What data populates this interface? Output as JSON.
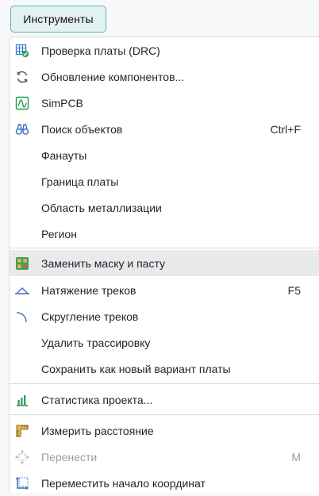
{
  "menubar": {
    "button_label": "Инструменты"
  },
  "menu": {
    "items": [
      {
        "label": "Проверка платы (DRC)",
        "shortcut": "",
        "icon": "drc-check-icon"
      },
      {
        "label": "Обновление компонентов...",
        "shortcut": "",
        "icon": "refresh-icon"
      },
      {
        "label": "SimPCB",
        "shortcut": "",
        "icon": "simpcb-icon"
      },
      {
        "label": "Поиск объектов",
        "shortcut": "Ctrl+F",
        "icon": "binoculars-icon"
      },
      {
        "label": "Фанауты",
        "shortcut": "",
        "submenu": ">"
      },
      {
        "label": "Граница платы",
        "shortcut": "",
        "submenu": ">"
      },
      {
        "label": "Область металлизации",
        "shortcut": "",
        "submenu": ">"
      },
      {
        "label": "Регион",
        "shortcut": "",
        "submenu": ">"
      },
      {
        "label": "Заменить маску и пасту",
        "shortcut": "",
        "icon": "mask-paste-icon"
      },
      {
        "label": "Натяжение треков",
        "shortcut": "F5",
        "icon": "track-tension-icon"
      },
      {
        "label": "Скругление треков",
        "shortcut": "",
        "icon": "track-rounding-icon"
      },
      {
        "label": "Удалить трассировку",
        "shortcut": ""
      },
      {
        "label": "Сохранить как новый вариант платы",
        "shortcut": ""
      },
      {
        "label": "Статистика проекта...",
        "shortcut": "",
        "icon": "bar-chart-icon"
      },
      {
        "label": "Измерить расстояние",
        "shortcut": "",
        "icon": "ruler-icon"
      },
      {
        "label": "Перенести",
        "shortcut": "M",
        "icon": "move-icon",
        "disabled": true
      },
      {
        "label": "Переместить начало координат",
        "shortcut": "",
        "icon": "origin-icon"
      }
    ]
  }
}
